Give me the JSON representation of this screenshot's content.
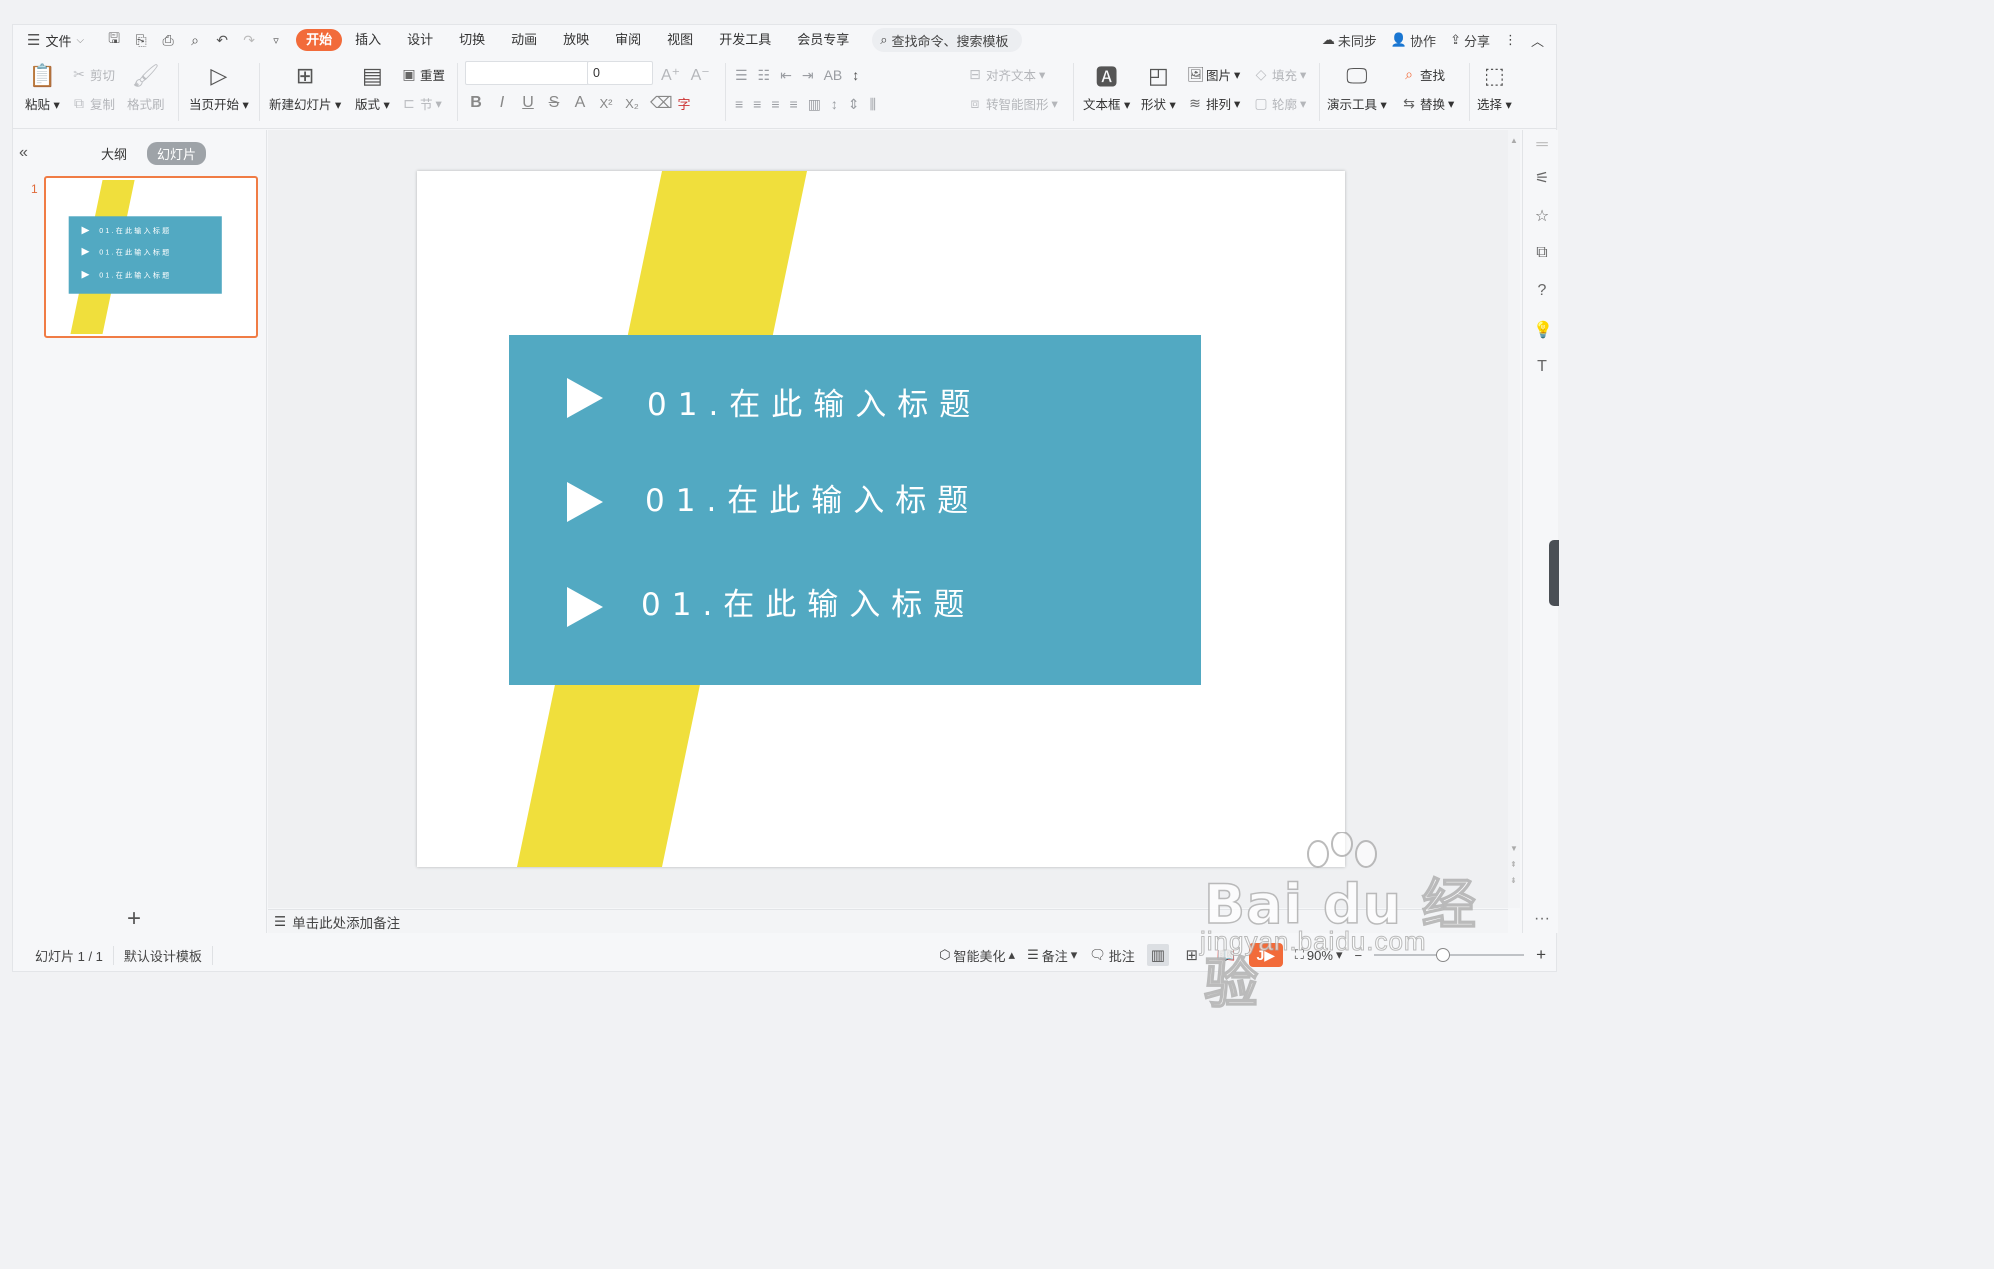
{
  "menubar": {
    "file": "文件",
    "tabs": [
      "开始",
      "插入",
      "设计",
      "切换",
      "动画",
      "放映",
      "审阅",
      "视图",
      "开发工具",
      "会员专享"
    ],
    "active_tab": "开始",
    "search_placeholder": "查找命令、搜索模板",
    "right": {
      "sync": "未同步",
      "collab": "协作",
      "share": "分享"
    }
  },
  "ribbon": {
    "paste": "粘贴",
    "cut": "剪切",
    "copy": "复制",
    "format_painter": "格式刷",
    "play_current": "当页开始",
    "new_slide": "新建幻灯片",
    "layout": "版式",
    "reset": "重置",
    "section": "节",
    "font_size": "0",
    "align_text": "对齐文本",
    "smart_art": "转智能图形",
    "text_box": "文本框",
    "shape": "形状",
    "picture": "图片",
    "arrange": "排列",
    "fill": "填充",
    "outline": "轮廓",
    "present_tools": "演示工具",
    "find": "查找",
    "replace": "替换",
    "select": "选择"
  },
  "panel": {
    "tab_outline": "大纲",
    "tab_slides": "幻灯片",
    "slide_number": "1"
  },
  "slide": {
    "items": [
      {
        "text": "01.在此输入标题"
      },
      {
        "text": "01.在此输入标题"
      },
      {
        "text": "01.在此输入标题"
      }
    ],
    "colors": {
      "box": "#52a9c2",
      "stripe": "#f0df3c",
      "text": "#ffffff"
    }
  },
  "notes_placeholder": "单击此处添加备注",
  "statusbar": {
    "slide_info": "幻灯片 1 / 1",
    "template": "默认设计模板",
    "beautify": "智能美化",
    "notes": "备注",
    "comments": "批注",
    "zoom": "90%"
  },
  "watermark": {
    "brand": "Bai du 经验",
    "url": "jingyan.baidu.com"
  }
}
